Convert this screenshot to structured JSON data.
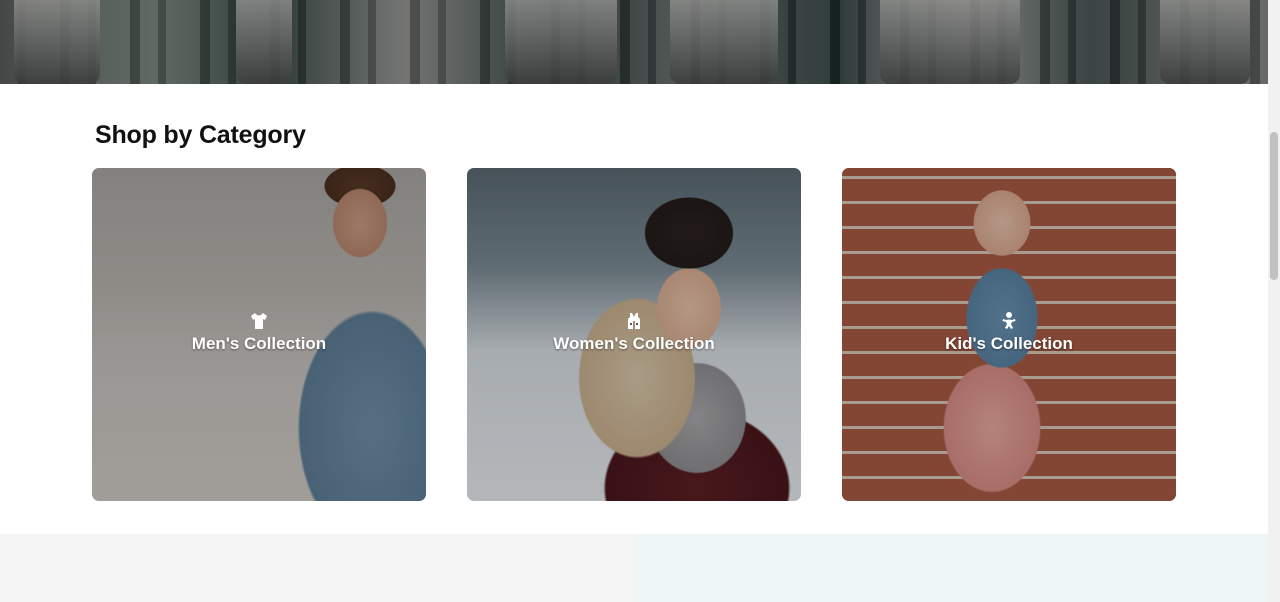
{
  "section": {
    "title": "Shop by Category"
  },
  "categories": [
    {
      "label": "Men's Collection",
      "icon": "tshirt-icon"
    },
    {
      "label": "Women's Collection",
      "icon": "vest-icon"
    },
    {
      "label": "Kid's Collection",
      "icon": "baby-icon"
    }
  ],
  "colors": {
    "label_text": "#ffffff",
    "title_text": "#111111",
    "footer_left": "#f5f5f5",
    "footer_right": "#eef7f6"
  }
}
